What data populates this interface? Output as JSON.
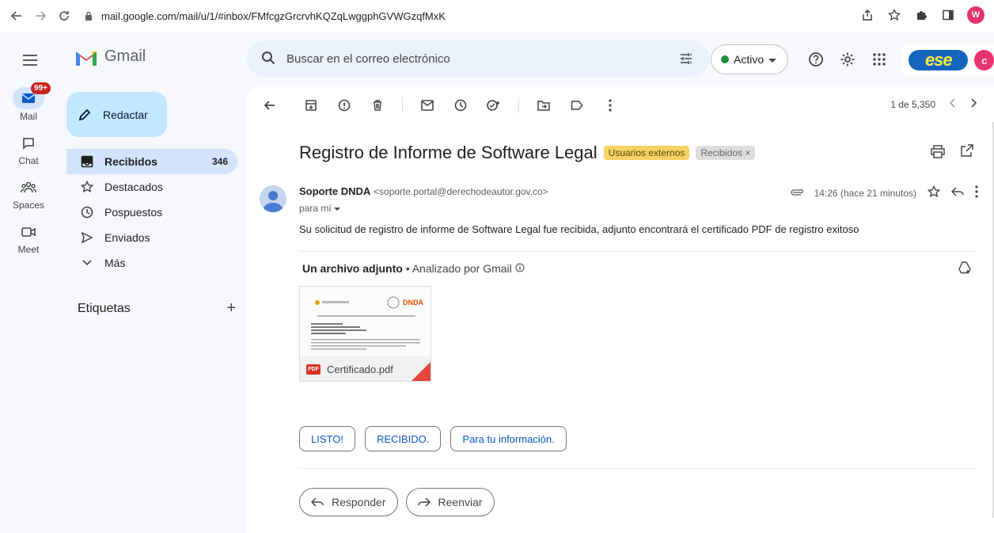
{
  "browser": {
    "url": "mail.google.com/mail/u/1/#inbox/FMfcgzGrcrvhKQZqLwggphGVWGzqfMxK",
    "profile_initial": "W"
  },
  "app": {
    "name": "Gmail"
  },
  "search": {
    "placeholder": "Buscar en el correo electrónico"
  },
  "status": {
    "label": "Activo"
  },
  "brand": {
    "logo_text": "ese",
    "account_initial": "c"
  },
  "rail": [
    {
      "label": "Mail",
      "badge": "99+"
    },
    {
      "label": "Chat"
    },
    {
      "label": "Spaces"
    },
    {
      "label": "Meet"
    }
  ],
  "sidebar": {
    "compose": "Redactar",
    "items": [
      {
        "label": "Recibidos",
        "count": "346"
      },
      {
        "label": "Destacados"
      },
      {
        "label": "Pospuestos"
      },
      {
        "label": "Enviados"
      },
      {
        "label": "Más"
      }
    ],
    "labels_heading": "Etiquetas",
    "labels_add": "+"
  },
  "toolbar": {
    "pager": "1 de 5,350"
  },
  "message": {
    "subject": "Registro de Informe de Software Legal",
    "label_external": "Usuarios externos",
    "label_inbox": "Recibidos ×",
    "sender_name": "Soporte DNDA",
    "sender_email": "<soporte.portal@derechodeautor.gov.co>",
    "recipient": "para mí",
    "time": "14:26 (hace 21 minutos)",
    "body": "Su solicitud de registro de informe de Software Legal fue recibida, adjunto encontrará el certificado PDF de registro exitoso"
  },
  "attachments": {
    "heading": "Un archivo adjunto",
    "scan_note": "Analizado por Gmail",
    "file_name": "Certificado.pdf",
    "pdf_badge": "PDF",
    "preview_brand": "DNDA"
  },
  "smart_replies": [
    "LISTO!",
    "RECIBIDO.",
    "Para tu información."
  ],
  "actions": {
    "reply": "Responder",
    "forward": "Reenviar"
  }
}
